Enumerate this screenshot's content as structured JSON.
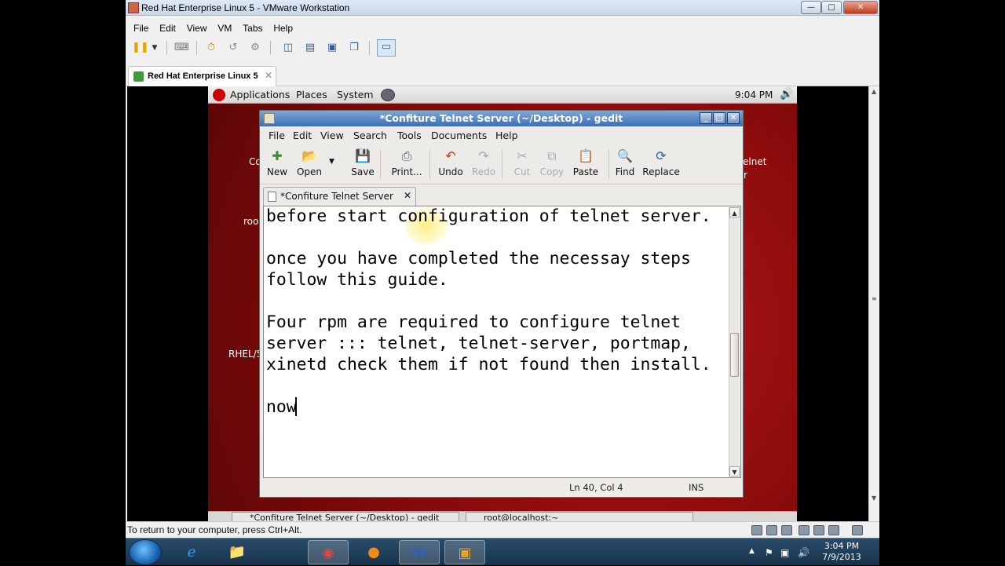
{
  "vmware": {
    "title": "Red Hat Enterprise Linux 5 - VMware Workstation",
    "menu": [
      "File",
      "Edit",
      "View",
      "VM",
      "Tabs",
      "Help"
    ],
    "tab_label": "Red Hat Enterprise Linux 5",
    "status_text": "To return to your computer, press Ctrl+Alt."
  },
  "gnome_panel": {
    "menus": [
      "Applications",
      "Places",
      "System"
    ],
    "clock": "9:04 PM"
  },
  "desktop": {
    "fragments": [
      "Co",
      "roo",
      "RHEL/5",
      "elnet",
      "r"
    ]
  },
  "gedit": {
    "title": "*Confiture Telnet Server (~/Desktop) - gedit",
    "menu": [
      "File",
      "Edit",
      "View",
      "Search",
      "Tools",
      "Documents",
      "Help"
    ],
    "toolbar": {
      "new": "New",
      "open": "Open",
      "save": "Save",
      "print": "Print...",
      "undo": "Undo",
      "redo": "Redo",
      "cut": "Cut",
      "copy": "Copy",
      "paste": "Paste",
      "find": "Find",
      "replace": "Replace"
    },
    "tab_label": "*Confiture Telnet Server",
    "lines": [
      "before start configuration of telnet server.",
      "",
      "once you have completed the necessay steps",
      "follow this guide.",
      "",
      "Four rpm are required to configure telnet",
      "server ::: telnet, telnet-server, portmap,",
      "xinetd check them if not found then install.",
      "",
      "now"
    ],
    "status": {
      "position": "Ln 40, Col 4",
      "mode": "INS"
    }
  },
  "guest_taskbar": {
    "items": [
      "*Confiture Telnet Server (~/Desktop) - gedit",
      "root@localhost:~"
    ]
  },
  "windows_taskbar": {
    "time": "3:04 PM",
    "date": "7/9/2013",
    "apps": [
      "internet-explorer",
      "file-explorer",
      "chrome",
      "firefox",
      "word",
      "vmware"
    ]
  }
}
